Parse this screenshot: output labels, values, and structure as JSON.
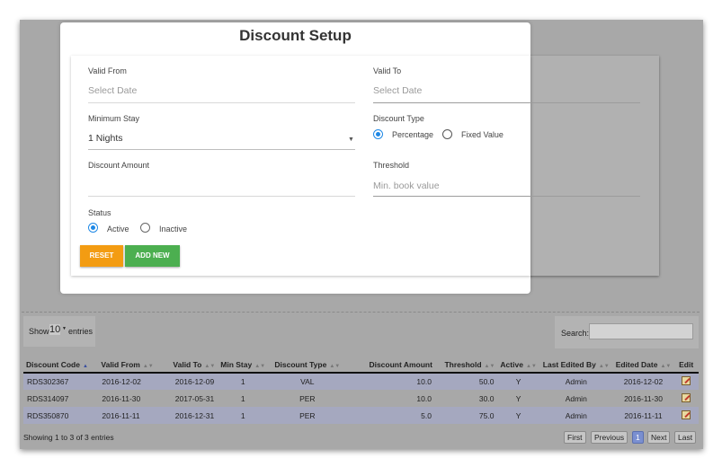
{
  "modal": {
    "title": "Discount Setup"
  },
  "form": {
    "valid_from": {
      "label": "Valid From",
      "placeholder": "Select Date"
    },
    "valid_to": {
      "label": "Valid To",
      "placeholder": "Select Date"
    },
    "minimum_stay": {
      "label": "Minimum Stay",
      "value": "1 Nights"
    },
    "discount_type": {
      "label": "Discount Type",
      "options": [
        "Percentage",
        "Fixed Value"
      ],
      "selected": "Percentage"
    },
    "discount_amount": {
      "label": "Discount Amount",
      "value": ""
    },
    "threshold": {
      "label": "Threshold",
      "placeholder": "Min. book value"
    },
    "status": {
      "label": "Status",
      "options": [
        "Active",
        "Inactive"
      ],
      "selected": "Active"
    },
    "reset_label": "RESET",
    "add_label": "ADD NEW"
  },
  "table_controls": {
    "show_label": "Show",
    "entries_value": "10",
    "entries_label": "entries",
    "search_label": "Search:"
  },
  "table": {
    "columns": [
      "Discount Code",
      "Valid From",
      "Valid To",
      "Min Stay",
      "Discount Type",
      "Discount Amount",
      "Threshold",
      "Active",
      "Last Edited By",
      "Edited Date",
      "Edit"
    ],
    "rows": [
      [
        "RDS302367",
        "2016-12-02",
        "2016-12-09",
        "1",
        "VAL",
        "10.0",
        "50.0",
        "Y",
        "Admin",
        "2016-12-02"
      ],
      [
        "RDS314097",
        "2016-11-30",
        "2017-05-31",
        "1",
        "PER",
        "10.0",
        "30.0",
        "Y",
        "Admin",
        "2016-11-30"
      ],
      [
        "RDS350870",
        "2016-11-11",
        "2016-12-31",
        "1",
        "PER",
        "5.0",
        "75.0",
        "Y",
        "Admin",
        "2016-11-11"
      ]
    ]
  },
  "footer": {
    "info": "Showing 1 to 3 of 3 entries",
    "pager": {
      "first": "First",
      "previous": "Previous",
      "current": "1",
      "next": "Next",
      "last": "Last"
    }
  },
  "colors": {
    "reset": "#f39c12",
    "add": "#4caf50",
    "radio_active": "#1e88e5",
    "overlay": "#a8a8a8"
  }
}
